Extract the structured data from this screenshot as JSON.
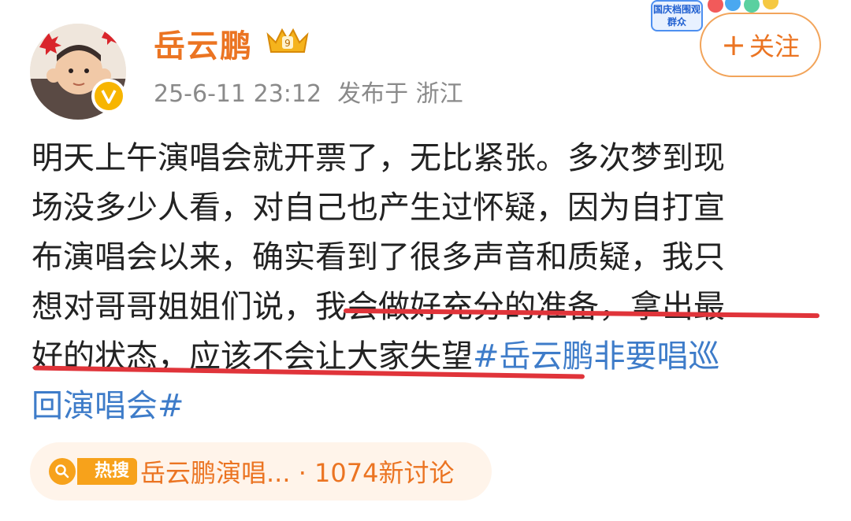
{
  "author": {
    "name": "岳云鹏",
    "vip_level": "9"
  },
  "event_sticker": {
    "text": "国庆档围观群众"
  },
  "meta": {
    "timestamp": "25-6-11 23:12",
    "location": "发布于 浙江"
  },
  "follow_button": {
    "plus": "+",
    "label": "关注"
  },
  "post": {
    "lines": [
      "明天上午演唱会就开票了，无比紧张。多次梦到现",
      "场没多少人看，对自己也产生过怀疑，因为自打宣",
      "布演唱会以来，确实看到了很多声音和质疑，我只"
    ],
    "line4_plain": "想对哥哥姐姐们说，",
    "line4_highlight": "我会做好充分的准备，拿出最",
    "line5_highlight": "好的状态，应该不会让大家失望",
    "hashtag_part1": "#岳云鹏非要唱巡",
    "hashtag_part2": "回演唱会#"
  },
  "hot_search": {
    "badge": "热搜",
    "topic": "岳云鹏演唱...",
    "separator": " · ",
    "discussion": "1074新讨论"
  },
  "colors": {
    "accent": "#eb7422",
    "hashtag": "#3e7cc9",
    "underline": "#e0343a",
    "hot_bg": "#fff4ea"
  }
}
